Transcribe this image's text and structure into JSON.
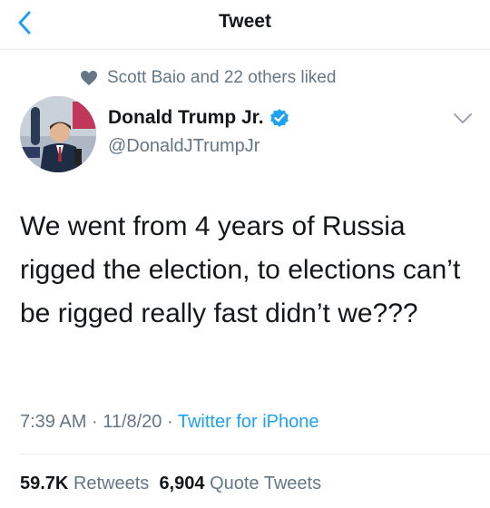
{
  "header": {
    "title": "Tweet"
  },
  "social_context": {
    "text": "Scott Baio and 22 others liked"
  },
  "author": {
    "name": "Donald Trump Jr.",
    "handle": "@DonaldJTrumpJr",
    "verified": true
  },
  "tweet": {
    "text": "We went from 4 years of Russia rigged the election, to elections can’t be rigged really fast didn’t we???",
    "time": "7:39 AM",
    "separator1": "·",
    "date": "11/8/20",
    "separator2": "·",
    "source": "Twitter for iPhone"
  },
  "stats": {
    "retweets_count": "59.7K",
    "retweets_label": "Retweets",
    "quotes_count": "6,904",
    "quotes_label": "Quote Tweets"
  },
  "colors": {
    "accent": "#1da1f2",
    "secondary_text": "#657786",
    "primary_text": "#14171a",
    "divider": "#e6ecf0"
  }
}
